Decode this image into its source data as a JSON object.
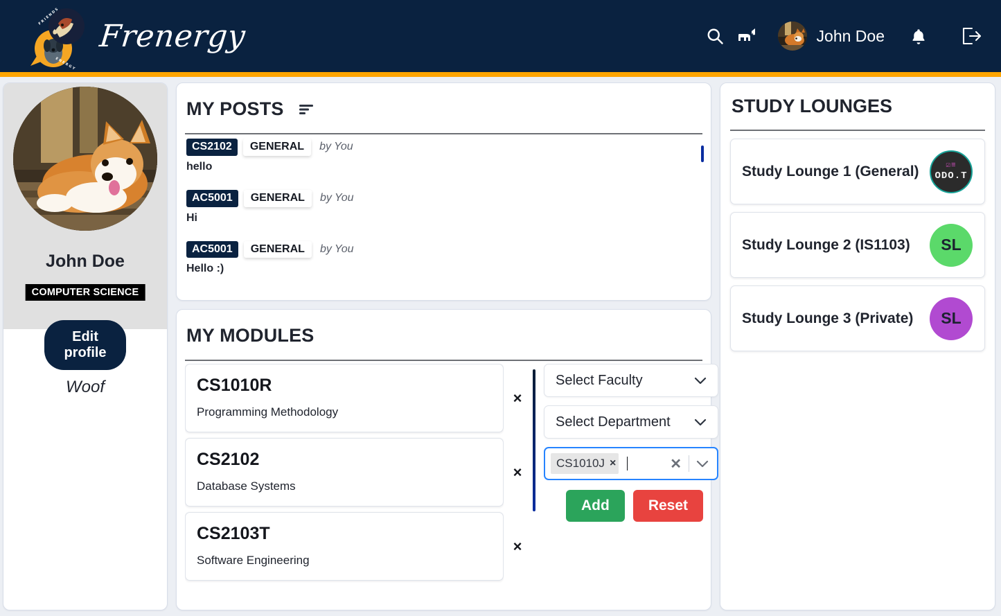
{
  "header": {
    "brand": "Frenergy",
    "logo_icon": "frenergy-dog-logo",
    "search_icon": "search-icon",
    "pets_icon": "dog-icon",
    "user_name": "John Doe",
    "user_avatar_icon": "user-avatar-corgi",
    "notifications_icon": "bell-icon",
    "logout_icon": "logout-icon",
    "bg_color": "#0a2240",
    "accent_color": "#ffa500"
  },
  "profile": {
    "avatar_icon": "profile-photo-corgi",
    "name": "John Doe",
    "faculty_tag": "COMPUTER SCIENCE",
    "edit_button": "Edit profile",
    "bio": "Woof"
  },
  "posts": {
    "title": "MY POSTS",
    "sort_icon": "sort-icon",
    "items": [
      {
        "module": "CS2102",
        "category": "GENERAL",
        "author": "by You",
        "body": "hello"
      },
      {
        "module": "AC5001",
        "category": "GENERAL",
        "author": "by You",
        "body": "Hi"
      },
      {
        "module": "AC5001",
        "category": "GENERAL",
        "author": "by You",
        "body": "Hello :)"
      }
    ]
  },
  "modules": {
    "title": "MY MODULES",
    "items": [
      {
        "code": "CS1010R",
        "name": "Programming Methodology",
        "remove_label": "×"
      },
      {
        "code": "CS2102",
        "name": "Database Systems",
        "remove_label": "×"
      },
      {
        "code": "CS2103T",
        "name": "Software Engineering",
        "remove_label": "×"
      }
    ],
    "form": {
      "faculty_select": "Select Faculty",
      "department_select": "Select Department",
      "module_chip": "CS1010J",
      "chip_remove_label": "×",
      "clear_label": "✕",
      "dropdown_icon": "chevron-down-icon",
      "add_label": "Add",
      "reset_label": "Reset",
      "add_color": "#2ba45b",
      "reset_color": "#e8433f"
    }
  },
  "lounges": {
    "title": "STUDY LOUNGES",
    "items": [
      {
        "name": "Study Lounge 1 (General)",
        "avatar_text": "ODO.T",
        "avatar_color": "#2b2b2b",
        "avatar_border": "#17a398",
        "avatar_style": "dark"
      },
      {
        "name": "Study Lounge 2 (IS1103)",
        "avatar_text": "SL",
        "avatar_color": "#5bd96a",
        "avatar_style": "plain"
      },
      {
        "name": "Study Lounge 3 (Private)",
        "avatar_text": "SL",
        "avatar_color": "#b14ad1",
        "avatar_style": "plain"
      }
    ]
  }
}
